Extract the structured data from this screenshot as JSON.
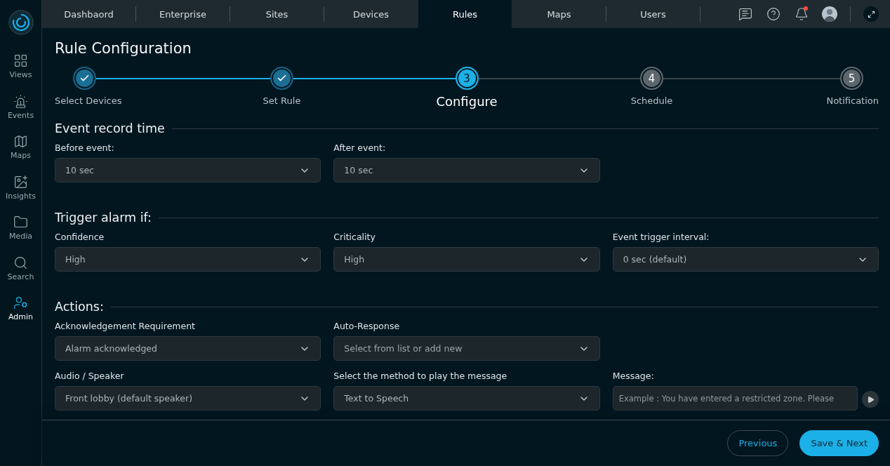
{
  "sidebar": {
    "items": [
      {
        "kind": "views",
        "label": "Views",
        "selected": false
      },
      {
        "kind": "events",
        "label": "Events",
        "selected": false
      },
      {
        "kind": "maps",
        "label": "Maps",
        "selected": false
      },
      {
        "kind": "insights",
        "label": "Insights",
        "selected": false
      },
      {
        "kind": "media",
        "label": "Media",
        "selected": false
      },
      {
        "kind": "search",
        "label": "Search",
        "selected": false
      },
      {
        "kind": "admin",
        "label": "Admin",
        "selected": true
      }
    ]
  },
  "tabs": [
    {
      "label": "Dashbaord",
      "selected": false
    },
    {
      "label": "Enterprise",
      "selected": false
    },
    {
      "label": "Sites",
      "selected": false
    },
    {
      "label": "Devices",
      "selected": false
    },
    {
      "label": "Rules",
      "selected": true
    },
    {
      "label": "Maps",
      "selected": false
    },
    {
      "label": "Users",
      "selected": false
    }
  ],
  "header_actions": {
    "notification_unread": true
  },
  "page_title": "Rule Configuration",
  "steps": [
    {
      "label": "Select Devices",
      "completed": true,
      "selected": false
    },
    {
      "label": "Set Rule",
      "completed": true,
      "selected": false
    },
    {
      "number": "3",
      "label": "Configure",
      "completed": false,
      "selected": true
    },
    {
      "number": "4",
      "label": "Schedule",
      "completed": false,
      "selected": false
    },
    {
      "number": "5",
      "label": "Notification",
      "completed": false,
      "selected": false
    }
  ],
  "sections": [
    {
      "title": "Event record time",
      "fields": [
        {
          "kind": "select",
          "label": "Before event:",
          "value": "10 sec"
        },
        {
          "kind": "select",
          "label": "After event:",
          "value": "10 sec"
        }
      ]
    },
    {
      "title": "Trigger alarm if:",
      "fields": [
        {
          "kind": "select",
          "label": "Confidence",
          "value": "High"
        },
        {
          "kind": "select",
          "label": "Criticality",
          "value": "High"
        },
        {
          "kind": "select",
          "label": "Event trigger interval:",
          "value": "0 sec (default)"
        }
      ]
    },
    {
      "title": "Actions:",
      "fields": [
        {
          "kind": "select",
          "label": "Acknowledgement Requirement",
          "value": "Alarm acknowledged"
        },
        {
          "kind": "select",
          "label": "Auto-Response",
          "placeholder": "Select from list or add new"
        },
        {
          "kind": "empty"
        },
        {
          "kind": "select",
          "label": "Audio / Speaker",
          "value": "Front lobby (default speaker)"
        },
        {
          "kind": "select",
          "label": "Select the method to play the message",
          "value": "Text to Speech"
        },
        {
          "kind": "message",
          "label": "Message:",
          "placeholder": "Example : You have entered a restricted zone. Please"
        }
      ]
    }
  ],
  "footer": {
    "buttons": [
      {
        "kind": "secondary",
        "label": "Previous"
      },
      {
        "kind": "primary",
        "label": "Save & Next"
      }
    ]
  }
}
